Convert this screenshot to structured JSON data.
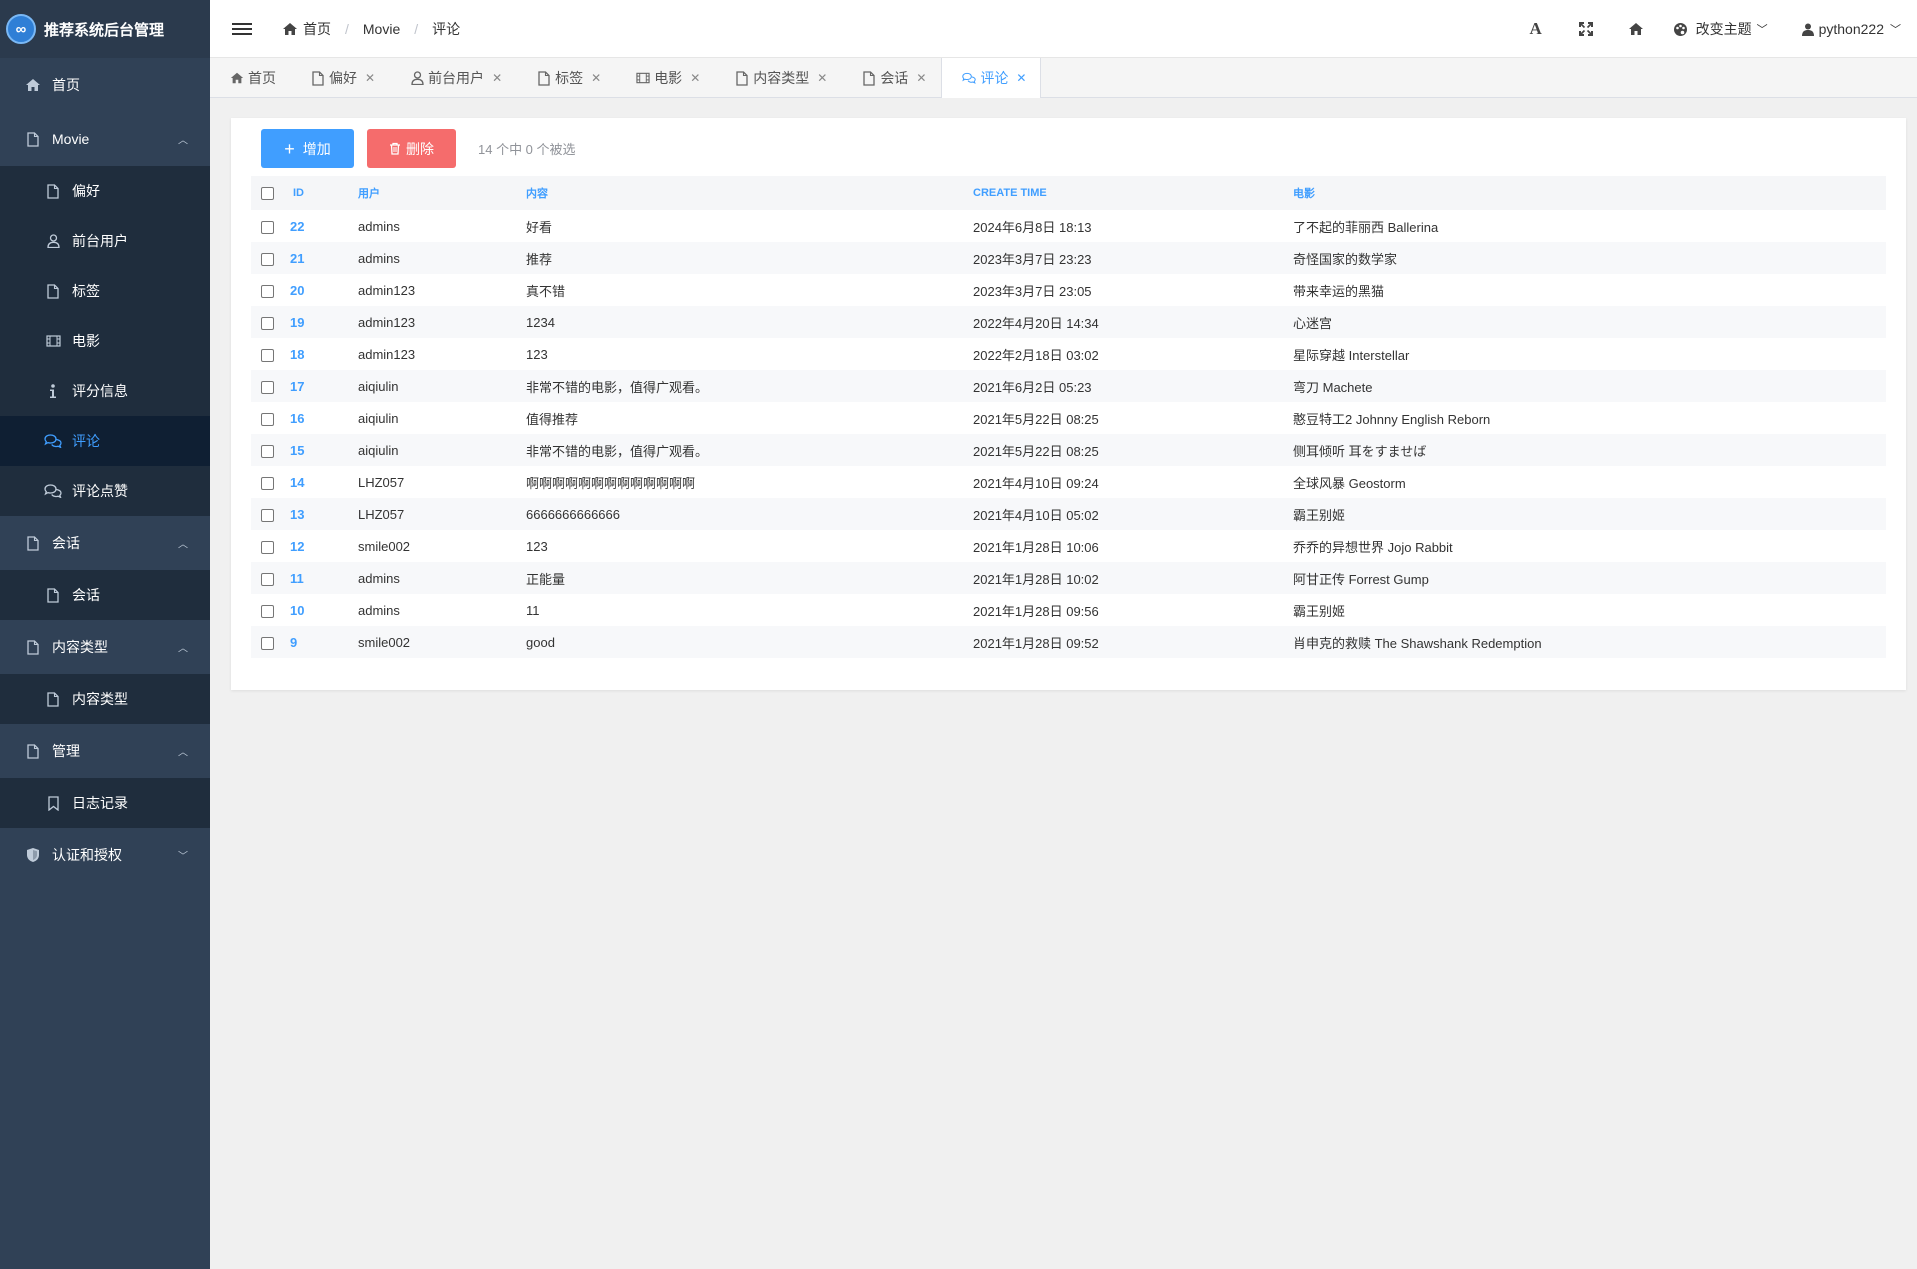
{
  "app": {
    "title": "推荐系统后台管理",
    "logo_glyph": "∞"
  },
  "sidebar": {
    "items": [
      {
        "label": "首页",
        "icon": "home-icon"
      },
      {
        "label": "Movie",
        "icon": "file-icon",
        "expanded": true
      },
      {
        "label": "偏好",
        "icon": "file-icon"
      },
      {
        "label": "前台用户",
        "icon": "user-icon"
      },
      {
        "label": "标签",
        "icon": "file-icon"
      },
      {
        "label": "电影",
        "icon": "film-icon"
      },
      {
        "label": "评分信息",
        "icon": "info-icon"
      },
      {
        "label": "评论",
        "icon": "comments-icon",
        "active": true
      },
      {
        "label": "评论点赞",
        "icon": "comments-icon"
      },
      {
        "label": "会话",
        "icon": "file-icon",
        "expanded": true
      },
      {
        "label": "会话",
        "icon": "file-icon"
      },
      {
        "label": "内容类型",
        "icon": "file-icon",
        "expanded": true
      },
      {
        "label": "内容类型",
        "icon": "file-icon"
      },
      {
        "label": "管理",
        "icon": "file-icon",
        "expanded": true
      },
      {
        "label": "日志记录",
        "icon": "bookmark-icon"
      },
      {
        "label": "认证和授权",
        "icon": "shield-icon",
        "expanded": false
      }
    ]
  },
  "header": {
    "breadcrumb": [
      "首页",
      "Movie",
      "评论"
    ],
    "theme_label": "改变主题",
    "username": "python222"
  },
  "tabs": [
    {
      "label": "首页",
      "icon": "home-icon",
      "closable": false
    },
    {
      "label": "偏好",
      "icon": "file-icon",
      "closable": true
    },
    {
      "label": "前台用户",
      "icon": "user-icon",
      "closable": true
    },
    {
      "label": "标签",
      "icon": "file-icon",
      "closable": true
    },
    {
      "label": "电影",
      "icon": "film-icon",
      "closable": true
    },
    {
      "label": "内容类型",
      "icon": "file-icon",
      "closable": true
    },
    {
      "label": "会话",
      "icon": "file-icon",
      "closable": true
    },
    {
      "label": "评论",
      "icon": "comments-icon",
      "closable": true,
      "active": true
    }
  ],
  "toolbar": {
    "add_label": "增加",
    "delete_label": "删除",
    "selected_info": "14 个中 0 个被选"
  },
  "table": {
    "headers": [
      "ID",
      "用户",
      "内容",
      "CREATE TIME",
      "电影"
    ],
    "rows": [
      [
        "22",
        "admins",
        "好看",
        "2024年6月8日 18:13",
        "了不起的菲丽西 Ballerina"
      ],
      [
        "21",
        "admins",
        "推荐",
        "2023年3月7日 23:23",
        "奇怪国家的数学家"
      ],
      [
        "20",
        "admin123",
        "真不错",
        "2023年3月7日 23:05",
        "带来幸运的黑猫"
      ],
      [
        "19",
        "admin123",
        "1234",
        "2022年4月20日 14:34",
        "心迷宫"
      ],
      [
        "18",
        "admin123",
        "123",
        "2022年2月18日 03:02",
        "星际穿越 Interstellar"
      ],
      [
        "17",
        "aiqiulin",
        "非常不错的电影，值得广观看。",
        "2021年6月2日 05:23",
        "弯刀 Machete"
      ],
      [
        "16",
        "aiqiulin",
        "值得推荐",
        "2021年5月22日 08:25",
        "憨豆特工2 Johnny English Reborn"
      ],
      [
        "15",
        "aiqiulin",
        "非常不错的电影，值得广观看。",
        "2021年5月22日 08:25",
        "侧耳倾听 耳をすませば"
      ],
      [
        "14",
        "LHZ057",
        "啊啊啊啊啊啊啊啊啊啊啊啊啊",
        "2021年4月10日 09:24",
        "全球风暴 Geostorm"
      ],
      [
        "13",
        "LHZ057",
        "6666666666666",
        "2021年4月10日 05:02",
        "霸王别姬"
      ],
      [
        "12",
        "smile002",
        "123",
        "2021年1月28日 10:06",
        "乔乔的异想世界 Jojo Rabbit"
      ],
      [
        "11",
        "admins",
        "正能量",
        "2021年1月28日 10:02",
        "阿甘正传 Forrest Gump"
      ],
      [
        "10",
        "admins",
        "11",
        "2021年1月28日 09:56",
        "霸王别姬"
      ],
      [
        "9",
        "smile002",
        "good",
        "2021年1月28日 09:52",
        "肖申克的救赎 The Shawshank Redemption"
      ]
    ]
  },
  "colors": {
    "sidebar_bg": "#304156",
    "submenu_bg": "#1f2d3d",
    "accent": "#409eff",
    "danger": "#f56c6c"
  }
}
